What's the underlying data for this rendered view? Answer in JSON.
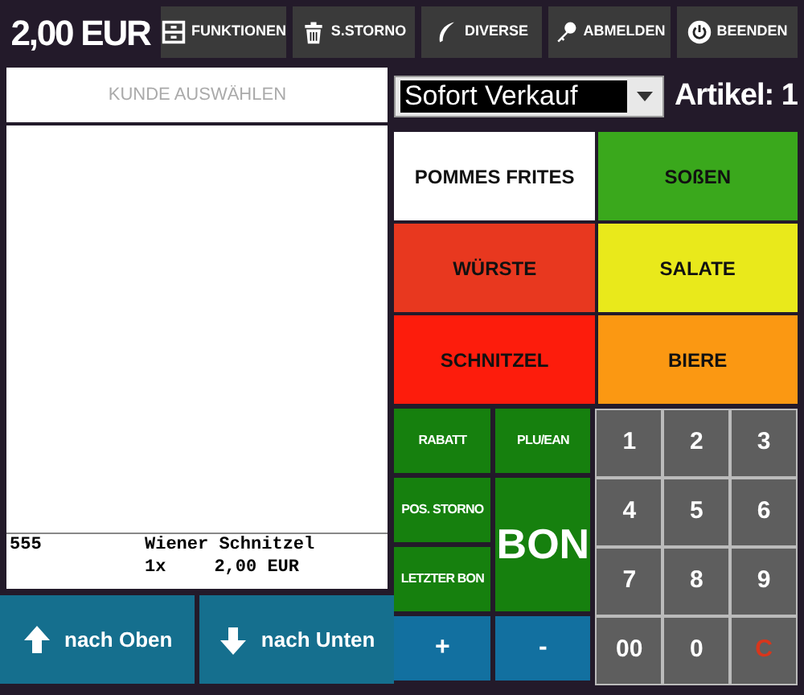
{
  "total": "2,00 EUR",
  "toolbar": [
    {
      "label": "FUNKTIONEN",
      "kind": "drawer"
    },
    {
      "label": "S.STORNO",
      "kind": "trash"
    },
    {
      "label": "DIVERSE",
      "kind": "feather"
    },
    {
      "label": "ABMELDEN",
      "kind": "key"
    },
    {
      "label": "BEENDEN",
      "kind": "power"
    }
  ],
  "customer": {
    "placeholder": "KUNDE AUSWÄHLEN"
  },
  "receipt": [
    {
      "plu": "555",
      "name": "Wiener Schnitzel",
      "qty": "1x",
      "price": "2,00 EUR"
    }
  ],
  "nav": [
    {
      "label": "nach Oben",
      "kind": "up"
    },
    {
      "label": "nach Unten",
      "kind": "down"
    }
  ],
  "mode": {
    "value": "Sofort Verkauf"
  },
  "article_count": "Artikel: 1",
  "categories": [
    {
      "label": "POMMES FRITES",
      "color": "#ffffff"
    },
    {
      "label": "SOßEN",
      "color": "#3aa81c"
    },
    {
      "label": "WÜRSTE",
      "color": "#e8381f"
    },
    {
      "label": "SALATE",
      "color": "#e9e91b"
    },
    {
      "label": "SCHNITZEL",
      "color": "#fd1c0c"
    },
    {
      "label": "BIERE",
      "color": "#fb9812"
    }
  ],
  "actions": [
    {
      "label": "RABATT",
      "kind": "green"
    },
    {
      "label": "PLU/EAN",
      "kind": "green"
    },
    {
      "label": "POS. STORNO",
      "kind": "green"
    },
    {
      "label": "BON",
      "kind": "large"
    },
    {
      "label": "LETZTER BON",
      "kind": "green"
    },
    {
      "label": "+",
      "kind": "blue"
    },
    {
      "label": "-",
      "kind": "blue"
    }
  ],
  "keypad": [
    {
      "label": "1",
      "kind": "digit"
    },
    {
      "label": "2",
      "kind": "digit"
    },
    {
      "label": "3",
      "kind": "digit"
    },
    {
      "label": "4",
      "kind": "digit"
    },
    {
      "label": "5",
      "kind": "digit"
    },
    {
      "label": "6",
      "kind": "digit"
    },
    {
      "label": "7",
      "kind": "digit"
    },
    {
      "label": "8",
      "kind": "digit"
    },
    {
      "label": "9",
      "kind": "digit"
    },
    {
      "label": "00",
      "kind": "digit"
    },
    {
      "label": "0",
      "kind": "digit"
    },
    {
      "label": "C",
      "kind": "clear"
    }
  ]
}
